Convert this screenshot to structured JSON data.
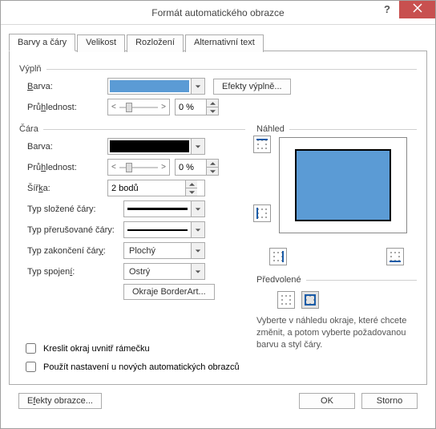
{
  "title": "Formát automatického obrazce",
  "tabs": [
    "Barvy a čáry",
    "Velikost",
    "Rozložení",
    "Alternativní text"
  ],
  "fill": {
    "group": "Výplň",
    "color_lbl": "Barva:",
    "color_val": "#5b9bd5",
    "effects_btn": "Efekty výplně...",
    "transparency_lbl": "Průhlednost:",
    "transparency_val": "0 %"
  },
  "line": {
    "group": "Čára",
    "color_lbl": "Barva:",
    "color_val": "#000000",
    "transparency_lbl": "Průhlednost:",
    "transparency_val": "0 %",
    "width_lbl": "Šířka:",
    "width_val": "2 bodů",
    "compound_lbl": "Typ složené čáry:",
    "dash_lbl": "Typ přerušované čáry:",
    "cap_lbl": "Typ zakončení čáry:",
    "cap_val": "Plochý",
    "join_lbl": "Typ spojení:",
    "join_val": "Ostrý",
    "borderart_btn": "Okraje BorderArt..."
  },
  "preview": {
    "group": "Náhled",
    "defaults_group": "Předvolené",
    "help": "Vyberte v náhledu okraje, které chcete změnit, a potom vyberte požadovanou barvu a styl čáry."
  },
  "checks": {
    "inside": "Kreslit okraj uvnitř rámečku",
    "apply_new": "Použít nastavení u nových automatických obrazců"
  },
  "footer": {
    "effects": "Efekty obrazce...",
    "ok": "OK",
    "cancel": "Storno"
  }
}
